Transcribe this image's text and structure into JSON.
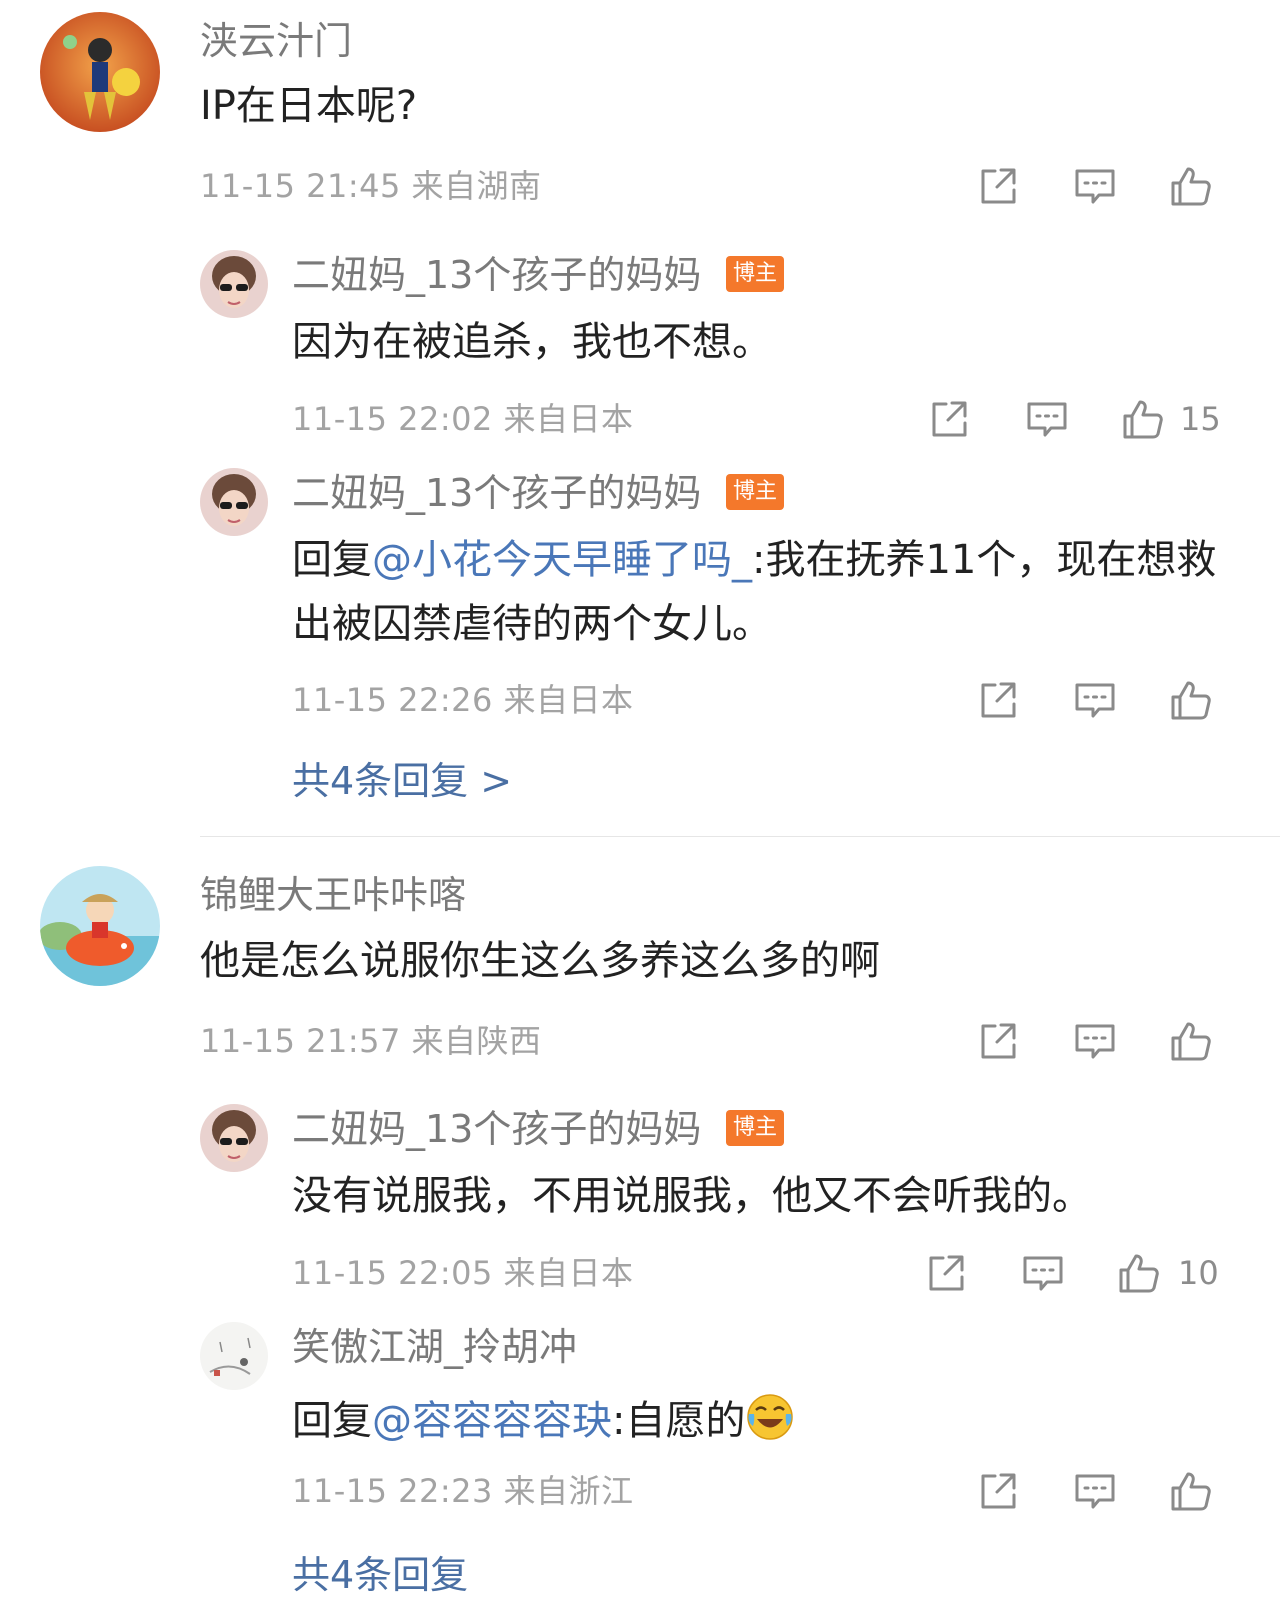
{
  "threads": [
    {
      "user": "浃云汁门",
      "text": "IP在日本呢?",
      "meta": "11-15 21:45 来自湖南",
      "replies": [
        {
          "user": "二妞妈_13个孩子的妈妈",
          "badge": "博主",
          "text": "因为在被追杀，我也不想。",
          "meta": "11-15 22:02 来自日本",
          "likes": "15"
        },
        {
          "user": "二妞妈_13个孩子的妈妈",
          "badge": "博主",
          "prefix": "回复",
          "mention": "@小花今天早睡了吗_",
          "text": ":我在抚养11个，现在想救出被囚禁虐待的两个女儿。",
          "meta": "11-15 22:26 来自日本"
        }
      ],
      "more": "共4条回复 >"
    },
    {
      "user": "锦鲤大王咔咔喀",
      "text": "他是怎么说服你生这么多养这么多的啊",
      "meta": "11-15 21:57 来自陕西",
      "replies": [
        {
          "user": "二妞妈_13个孩子的妈妈",
          "badge": "博主",
          "text": "没有说服我，不用说服我，他又不会听我的。",
          "meta": "11-15 22:05 来自日本",
          "likes": "10"
        },
        {
          "user": "笑傲江湖_拎胡冲",
          "prefix": "回复",
          "mention": "@容容容容玦",
          "text": ":自愿的",
          "emoji": "laugh-cry-emoji",
          "meta": "11-15 22:23 来自浙江"
        }
      ],
      "more": "共4条回复"
    }
  ],
  "colors": {
    "badge": "#f4782b",
    "mention": "#4a77b8",
    "more": "#4a6fa3",
    "meta": "#a3a3a3"
  },
  "icons": [
    "share-icon",
    "comment-icon",
    "like-icon"
  ]
}
